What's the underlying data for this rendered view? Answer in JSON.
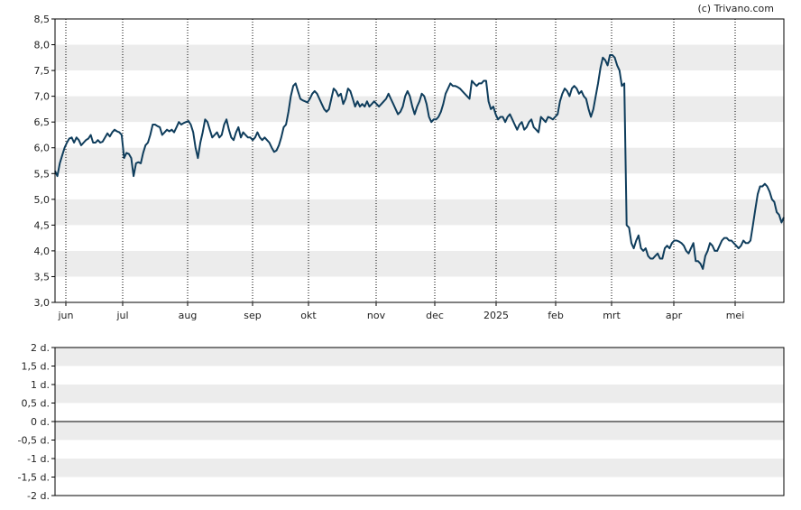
{
  "copyright": "(c) Trivano.com",
  "colors": {
    "line": "#0f3d5c",
    "band": "#ececec",
    "grid": "#000000",
    "frame": "#000000",
    "text": "#222222"
  },
  "chart_data": [
    {
      "type": "line",
      "ylim": [
        3.0,
        8.5
      ],
      "grid": true,
      "y_ticks": [
        "3,0",
        "3,5",
        "4,0",
        "4,5",
        "5,0",
        "5,5",
        "6,0",
        "6,5",
        "7,0",
        "7,5",
        "8,0",
        "8,5"
      ],
      "x_ticks": [
        "jun",
        "jul",
        "aug",
        "sep",
        "okt",
        "nov",
        "dec",
        "2025",
        "feb",
        "mrt",
        "apr",
        "mei"
      ],
      "series": [
        {
          "values": [
            5.55,
            5.45,
            5.7,
            5.85,
            6.0,
            6.1,
            6.18,
            6.2,
            6.1,
            6.2,
            6.15,
            6.05,
            6.1,
            6.15,
            6.18,
            6.25,
            6.1,
            6.1,
            6.15,
            6.1,
            6.12,
            6.2,
            6.28,
            6.22,
            6.3,
            6.35,
            6.32,
            6.3,
            6.25,
            5.8,
            5.9,
            5.88,
            5.8,
            5.45,
            5.7,
            5.72,
            5.7,
            5.9,
            6.05,
            6.1,
            6.25,
            6.45,
            6.45,
            6.42,
            6.4,
            6.25,
            6.3,
            6.35,
            6.32,
            6.35,
            6.3,
            6.4,
            6.5,
            6.45,
            6.48,
            6.5,
            6.52,
            6.45,
            6.3,
            6.0,
            5.8,
            6.1,
            6.3,
            6.55,
            6.5,
            6.35,
            6.2,
            6.25,
            6.3,
            6.2,
            6.25,
            6.45,
            6.55,
            6.35,
            6.2,
            6.15,
            6.3,
            6.4,
            6.2,
            6.3,
            6.25,
            6.2,
            6.2,
            6.15,
            6.2,
            6.3,
            6.2,
            6.15,
            6.2,
            6.15,
            6.1,
            6.0,
            5.92,
            5.95,
            6.05,
            6.2,
            6.4,
            6.45,
            6.7,
            7.0,
            7.2,
            7.25,
            7.1,
            6.95,
            6.92,
            6.9,
            6.88,
            6.95,
            7.05,
            7.1,
            7.05,
            6.95,
            6.85,
            6.75,
            6.7,
            6.75,
            6.95,
            7.15,
            7.1,
            7.0,
            7.05,
            6.85,
            6.95,
            7.15,
            7.1,
            6.95,
            6.8,
            6.9,
            6.8,
            6.85,
            6.8,
            6.9,
            6.8,
            6.85,
            6.9,
            6.85,
            6.8,
            6.85,
            6.9,
            6.95,
            7.05,
            6.95,
            6.85,
            6.75,
            6.65,
            6.7,
            6.8,
            7.0,
            7.1,
            7.0,
            6.8,
            6.65,
            6.8,
            6.9,
            7.05,
            7.0,
            6.85,
            6.6,
            6.5,
            6.55,
            6.55,
            6.6,
            6.7,
            6.85,
            7.05,
            7.15,
            7.25,
            7.2,
            7.2,
            7.18,
            7.15,
            7.1,
            7.05,
            7.0,
            6.95,
            7.3,
            7.25,
            7.2,
            7.25,
            7.25,
            7.3,
            7.3,
            6.9,
            6.75,
            6.8,
            6.65,
            6.55,
            6.6,
            6.6,
            6.5,
            6.6,
            6.65,
            6.55,
            6.45,
            6.35,
            6.45,
            6.5,
            6.35,
            6.4,
            6.5,
            6.55,
            6.4,
            6.35,
            6.3,
            6.6,
            6.55,
            6.5,
            6.6,
            6.58,
            6.55,
            6.6,
            6.65,
            6.9,
            7.05,
            7.15,
            7.1,
            7.0,
            7.15,
            7.2,
            7.15,
            7.05,
            7.1,
            7.0,
            6.95,
            6.75,
            6.6,
            6.75,
            7.0,
            7.25,
            7.55,
            7.75,
            7.7,
            7.6,
            7.8,
            7.8,
            7.75,
            7.6,
            7.5,
            7.2,
            7.25,
            4.5,
            4.45,
            4.15,
            4.05,
            4.2,
            4.3,
            4.05,
            4.0,
            4.05,
            3.9,
            3.85,
            3.85,
            3.9,
            3.95,
            3.85,
            3.85,
            4.05,
            4.1,
            4.05,
            4.15,
            4.2,
            4.2,
            4.18,
            4.15,
            4.1,
            4.0,
            3.95,
            4.05,
            4.15,
            3.8,
            3.8,
            3.75,
            3.65,
            3.9,
            4.0,
            4.15,
            4.1,
            4.0,
            4.0,
            4.1,
            4.2,
            4.25,
            4.25,
            4.2,
            4.2,
            4.15,
            4.1,
            4.05,
            4.1,
            4.2,
            4.15,
            4.15,
            4.2,
            4.5,
            4.8,
            5.1,
            5.25,
            5.25,
            5.3,
            5.25,
            5.15,
            5.0,
            4.95,
            4.75,
            4.7,
            4.55,
            4.65
          ]
        }
      ]
    },
    {
      "type": "line",
      "ylim": [
        -2,
        2
      ],
      "grid": true,
      "y_ticks": [
        "2 d.",
        "1,5 d.",
        "1 d.",
        "0,5 d.",
        "0 d.",
        "-0,5 d.",
        "-1 d.",
        "-1,5 d.",
        "-2 d."
      ],
      "series": []
    }
  ]
}
